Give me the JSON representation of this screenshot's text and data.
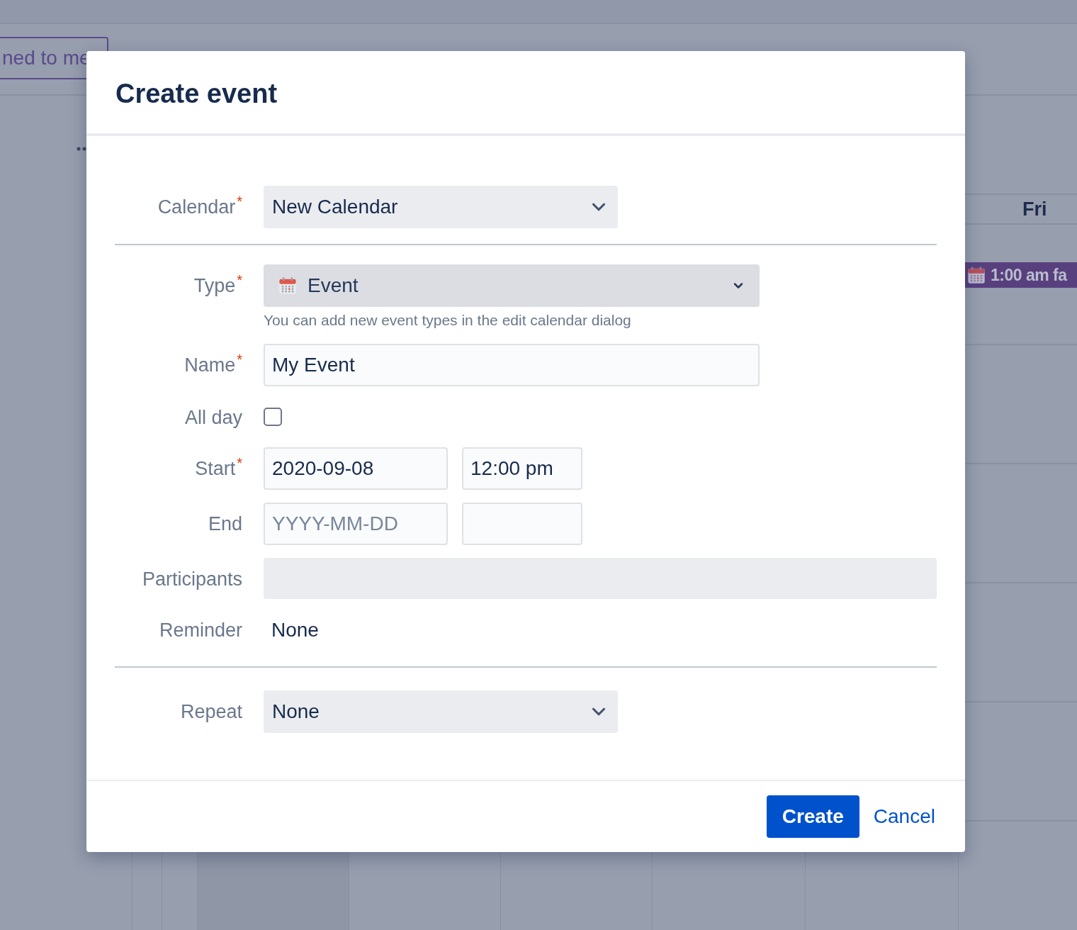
{
  "background": {
    "filter_button": "ned to me",
    "day_header": "Fri",
    "event": {
      "label": "1:00 am fa"
    }
  },
  "dialog": {
    "title": "Create event",
    "required_mark": "*",
    "sections": [
      [
        {
          "kind": "select",
          "label": "Calendar",
          "required": true,
          "value": "New Calendar"
        }
      ],
      [
        {
          "kind": "icon_select",
          "label": "Type",
          "required": true,
          "value": "Event",
          "help": "You can add new event types in the edit calendar dialog"
        },
        {
          "kind": "text",
          "label": "Name",
          "required": true,
          "value": "My Event"
        },
        {
          "kind": "checkbox",
          "label": "All day",
          "required": false,
          "checked": false
        },
        {
          "kind": "datetime",
          "label": "Start",
          "required": true,
          "date": "2020-09-08",
          "time": "12:00 pm"
        },
        {
          "kind": "datetime",
          "label": "End",
          "required": false,
          "date_placeholder": "YYYY-MM-DD"
        },
        {
          "kind": "participants",
          "label": "Participants",
          "required": false
        },
        {
          "kind": "static",
          "label": "Reminder",
          "required": false,
          "value": "None"
        }
      ],
      [
        {
          "kind": "select",
          "label": "Repeat",
          "required": false,
          "value": "None"
        }
      ]
    ],
    "buttons": {
      "primary": "Create",
      "secondary": "Cancel"
    }
  }
}
